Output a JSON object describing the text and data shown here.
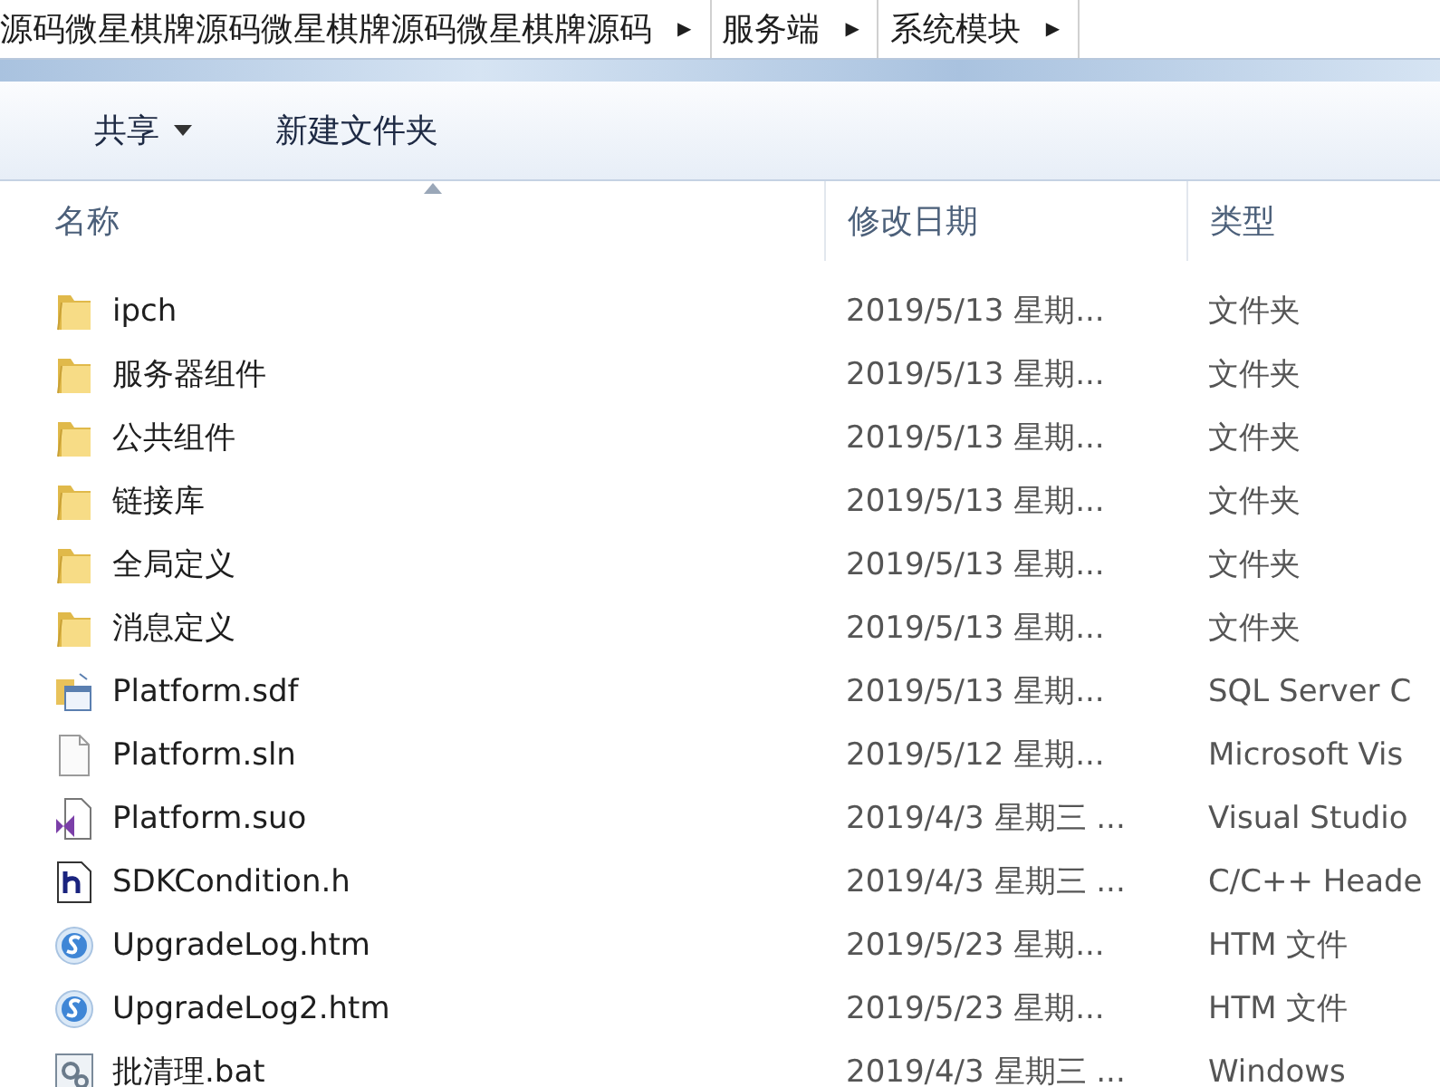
{
  "breadcrumb": [
    {
      "label": "源码微星棋牌源码微星棋牌源码微星棋牌源码",
      "arrow": "▶"
    },
    {
      "label": "服务端",
      "arrow": "▶"
    },
    {
      "label": "系统模块",
      "arrow": "▶"
    }
  ],
  "toolbar": [
    {
      "label": "共享",
      "dropdown": true
    },
    {
      "label": "新建文件夹",
      "dropdown": false
    }
  ],
  "table": {
    "columns": [
      {
        "label": "名称",
        "sorted": true
      },
      {
        "label": "修改日期",
        "sorted": false
      },
      {
        "label": "类型",
        "sorted": false
      }
    ],
    "rows": [
      {
        "kind": "folder",
        "name": "ipch",
        "date": "2019/5/13 星期...",
        "type": "文件夹"
      },
      {
        "kind": "folder",
        "name": "服务器组件",
        "date": "2019/5/13 星期...",
        "type": "文件夹"
      },
      {
        "kind": "folder",
        "name": "公共组件",
        "date": "2019/5/13 星期...",
        "type": "文件夹"
      },
      {
        "kind": "folder",
        "name": "链接库",
        "date": "2019/5/13 星期...",
        "type": "文件夹"
      },
      {
        "kind": "folder",
        "name": "全局定义",
        "date": "2019/5/13 星期...",
        "type": "文件夹"
      },
      {
        "kind": "folder",
        "name": "消息定义",
        "date": "2019/5/13 星期...",
        "type": "文件夹"
      },
      {
        "kind": "database",
        "name": "Platform.sdf",
        "date": "2019/5/13 星期...",
        "type": "SQL Server C"
      },
      {
        "kind": "file",
        "name": "Platform.sln",
        "date": "2019/5/12 星期...",
        "type": "Microsoft Vis"
      },
      {
        "kind": "vs",
        "name": "Platform.suo",
        "date": "2019/4/3 星期三 ...",
        "type": "Visual Studio"
      },
      {
        "kind": "header",
        "name": "SDKCondition.h",
        "date": "2019/4/3 星期三 ...",
        "type": "C/C++ Heade"
      },
      {
        "kind": "web",
        "name": "UpgradeLog.htm",
        "date": "2019/5/23 星期...",
        "type": "HTM 文件"
      },
      {
        "kind": "web",
        "name": "UpgradeLog2.htm",
        "date": "2019/5/23 星期...",
        "type": "HTM 文件"
      },
      {
        "kind": "batch",
        "name": "批清理.bat",
        "date": "2019/4/3 星期三 ...",
        "type": "Windows"
      }
    ]
  }
}
